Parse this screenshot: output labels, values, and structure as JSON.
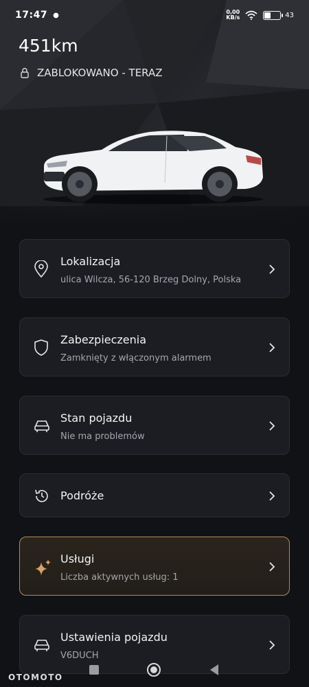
{
  "status_bar": {
    "time": "17:47",
    "net_speed_value": "0,00",
    "net_speed_unit": "KB/s",
    "battery_level": 0.43,
    "battery_text": "43"
  },
  "vehicle": {
    "range": "451km",
    "lock_status": "ZABLOKOWANO - TERAZ"
  },
  "cards": [
    {
      "icon": "location-pin-icon",
      "title": "Lokalizacja",
      "subtitle": "ulica Wilcza, 56-120 Brzeg Dolny, Polska"
    },
    {
      "icon": "shield-icon",
      "title": "Zabezpieczenia",
      "subtitle": "Zamknięty z włączonym alarmem"
    },
    {
      "icon": "car-icon",
      "title": "Stan pojazdu",
      "subtitle": "Nie ma problemów"
    },
    {
      "icon": "history-icon",
      "title": "Podróże",
      "subtitle": ""
    },
    {
      "icon": "sparkle-icon",
      "title": "Usługi",
      "subtitle": "Liczba aktywnych usług: 1"
    },
    {
      "icon": "car-icon",
      "title": "Ustawienia pojazdu",
      "subtitle": "V6DUCH"
    }
  ],
  "colors": {
    "background": "#111215",
    "card": "#1b1d22",
    "accent_gold": "#b08d5a",
    "subtitle": "#a4a7ad"
  },
  "watermark": "OTOMOTO"
}
